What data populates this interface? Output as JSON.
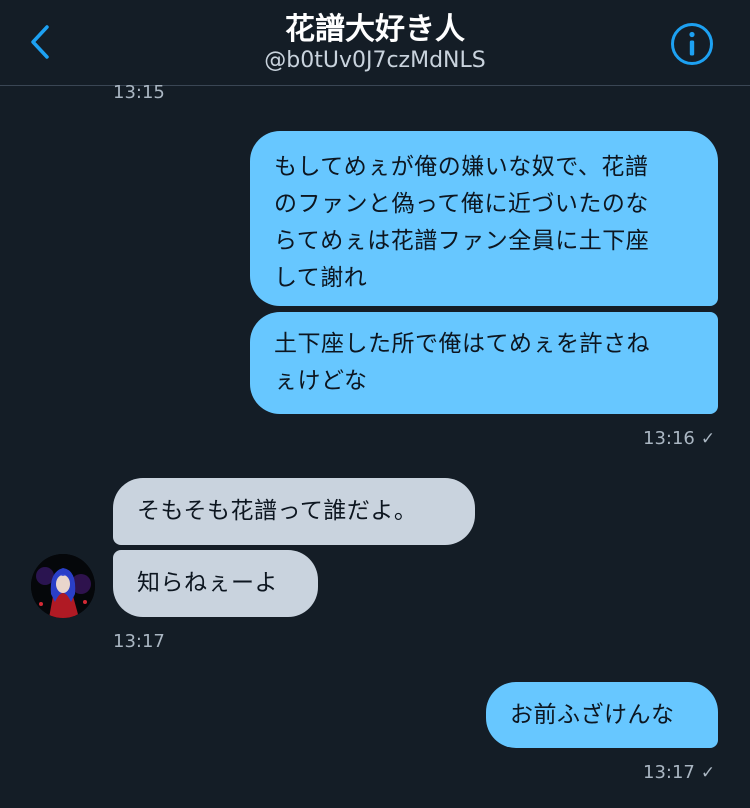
{
  "header": {
    "title": "花譜大好き人",
    "handle": "@b0tUv0J7czMdNLS"
  },
  "icons": {
    "back": "chevron-left-icon",
    "info": "info-circle-icon",
    "read": "checkmark-icon"
  },
  "colors": {
    "background": "#141d26",
    "sent_bubble": "#67c7ff",
    "received_bubble": "#c9d3de",
    "accent": "#1da1f2"
  },
  "messages": {
    "top_timestamp": "13:15",
    "m1_lines": [
      "もしてめぇが俺の嫌いな奴で、花譜",
      "のファンと偽って俺に近づいたのな",
      "らてめぇは花譜ファン全員に土下座",
      "して謝れ"
    ],
    "m2_lines": [
      "土下座した所で俺はてめぇを許さね",
      "ぇけどな"
    ],
    "ts_sent_1": "13:16",
    "check": "✓",
    "m3": "そもそも花譜って誰だよ。",
    "m4": "知らねぇーよ",
    "ts_recv": "13:17",
    "m5": "お前ふざけんな",
    "ts_sent_2": "13:17"
  }
}
